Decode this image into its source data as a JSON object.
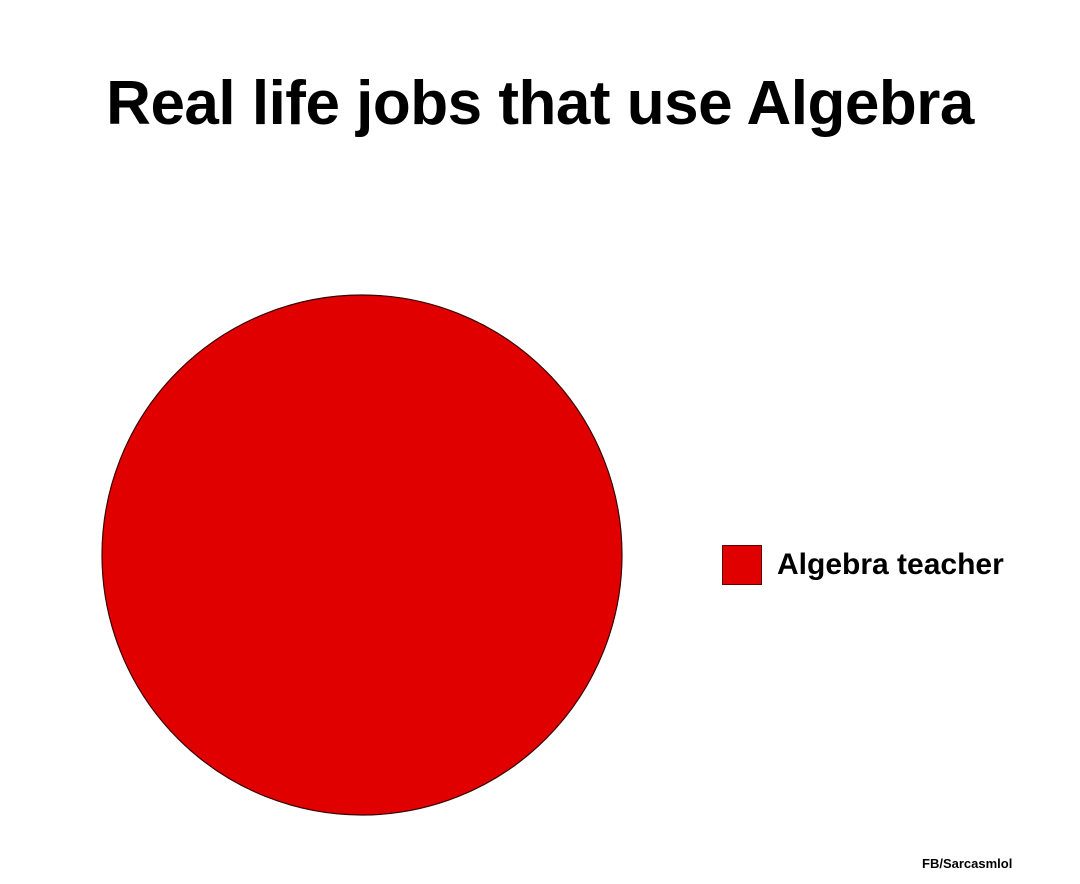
{
  "chart_data": {
    "type": "pie",
    "title": "Real life jobs that use Algebra",
    "categories": [
      "Algebra teacher"
    ],
    "values": [
      100
    ],
    "colors": [
      "#e00000"
    ],
    "legend_position": "right"
  },
  "credit": "FB/Sarcasmlol"
}
